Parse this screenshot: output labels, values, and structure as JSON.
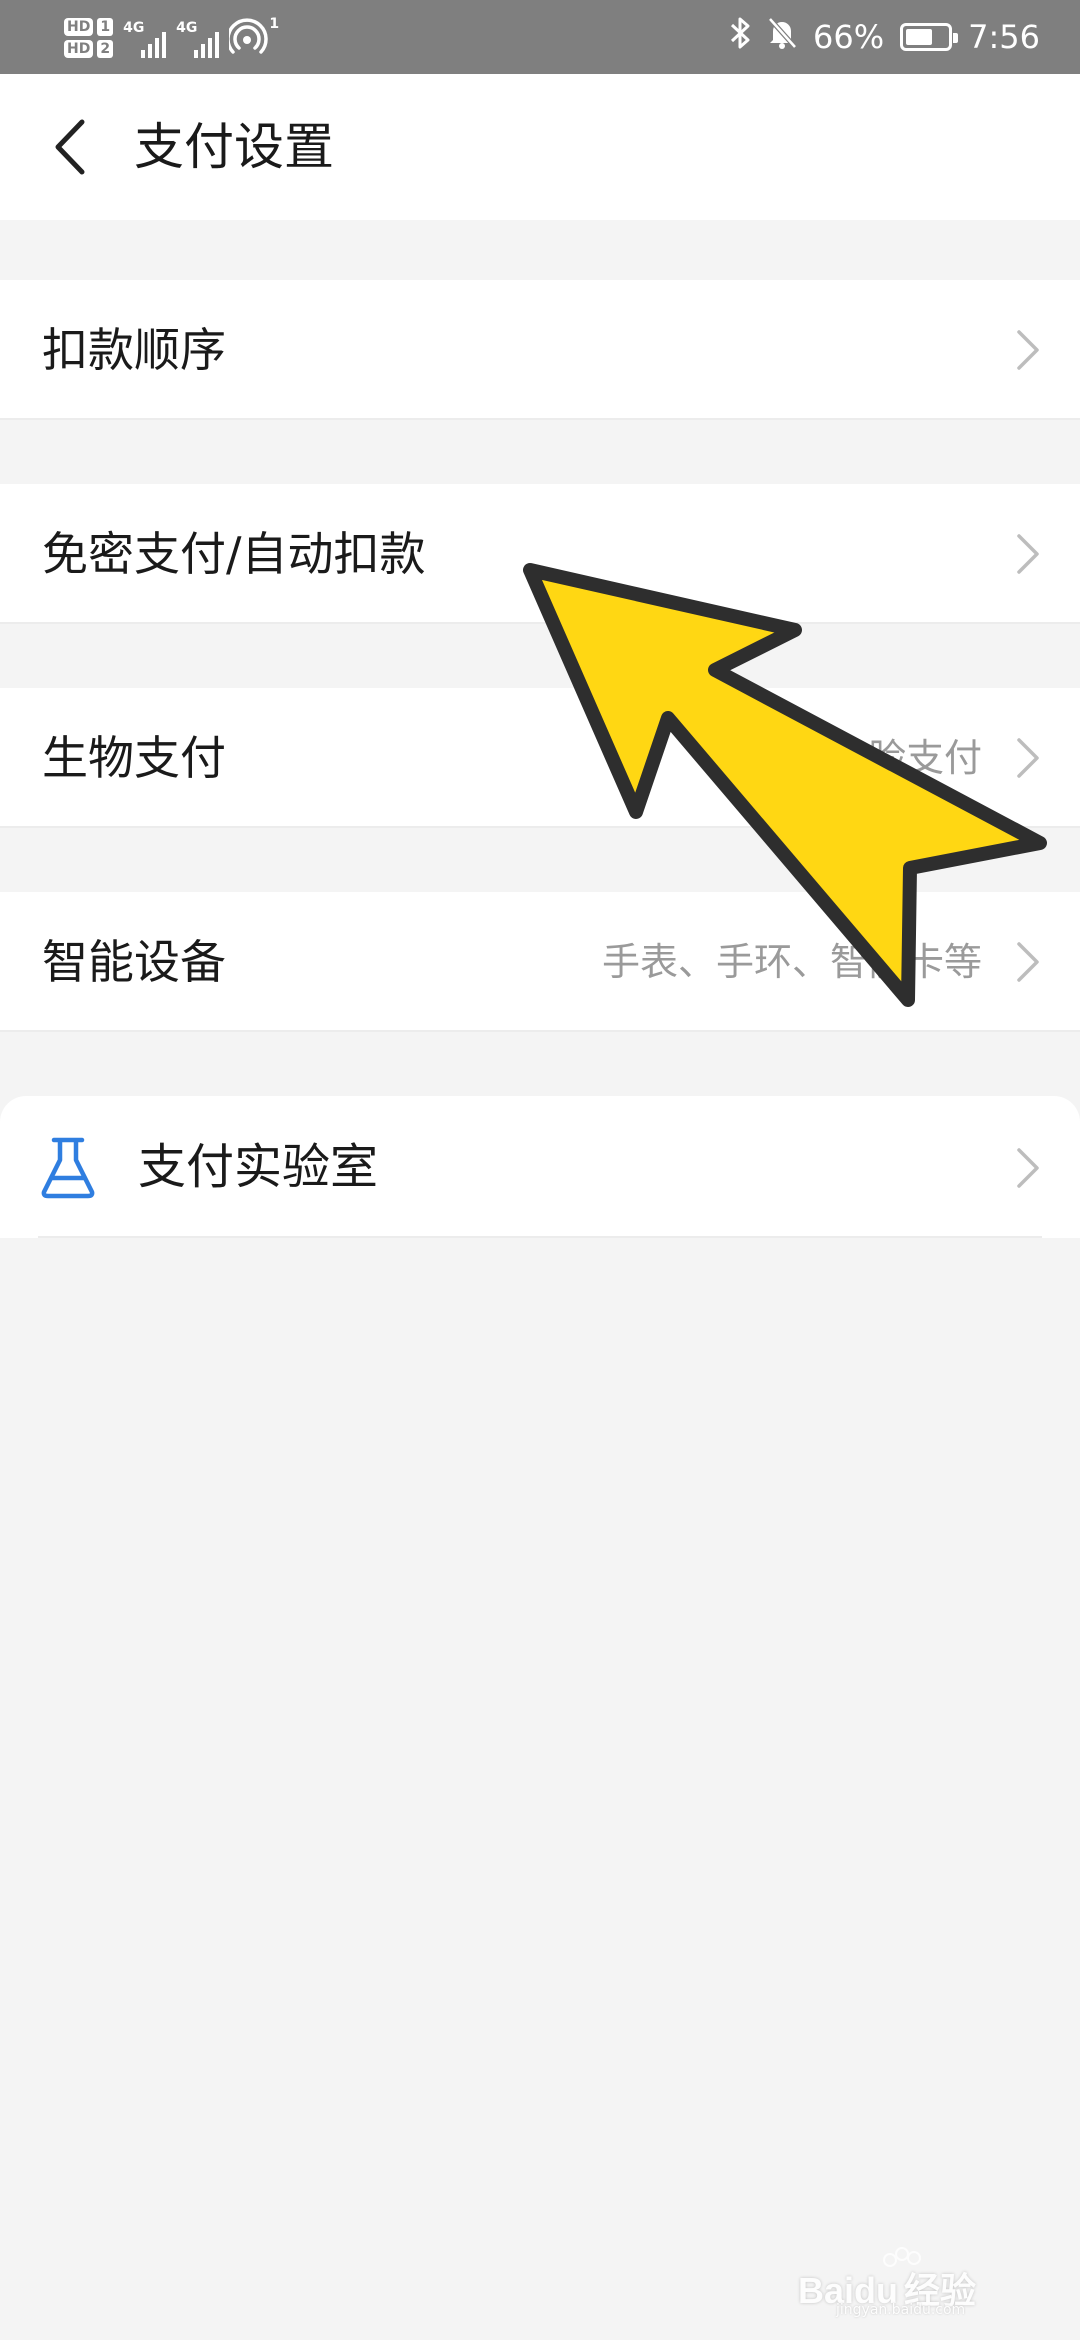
{
  "status_bar": {
    "hd1": "HD",
    "sim1": "1",
    "hd2": "HD",
    "sim2": "2",
    "network1": "4G",
    "network2": "4G",
    "hotspot_sup": "1",
    "battery_percent": "66%",
    "battery_level": 0.66,
    "time": "7:56",
    "icons": [
      "bluetooth-icon",
      "mute-bell-icon",
      "battery-icon",
      "wifi-hotspot-icon"
    ]
  },
  "header": {
    "title": "支付设置",
    "back_icon": "chevron-left-icon"
  },
  "rows": [
    {
      "label": "扣款顺序",
      "sub": ""
    },
    {
      "label": "免密支付/自动扣款",
      "sub": ""
    },
    {
      "label": "生物支付",
      "sub": "指纹、人脸支付"
    },
    {
      "label": "智能设备",
      "sub": "手表、手环、智能卡等"
    }
  ],
  "lab": {
    "label": "支付实验室",
    "icon": "flask-icon"
  },
  "colors": {
    "status_bar_bg": "#7f7f7f",
    "arrow_fill": "#ffd713",
    "arrow_stroke": "#2e2e2e",
    "flask_blue": "#2f7ee0"
  },
  "watermark": {
    "brand": "Baidu",
    "text": "经验",
    "url": "jingyan.baidu.com"
  }
}
